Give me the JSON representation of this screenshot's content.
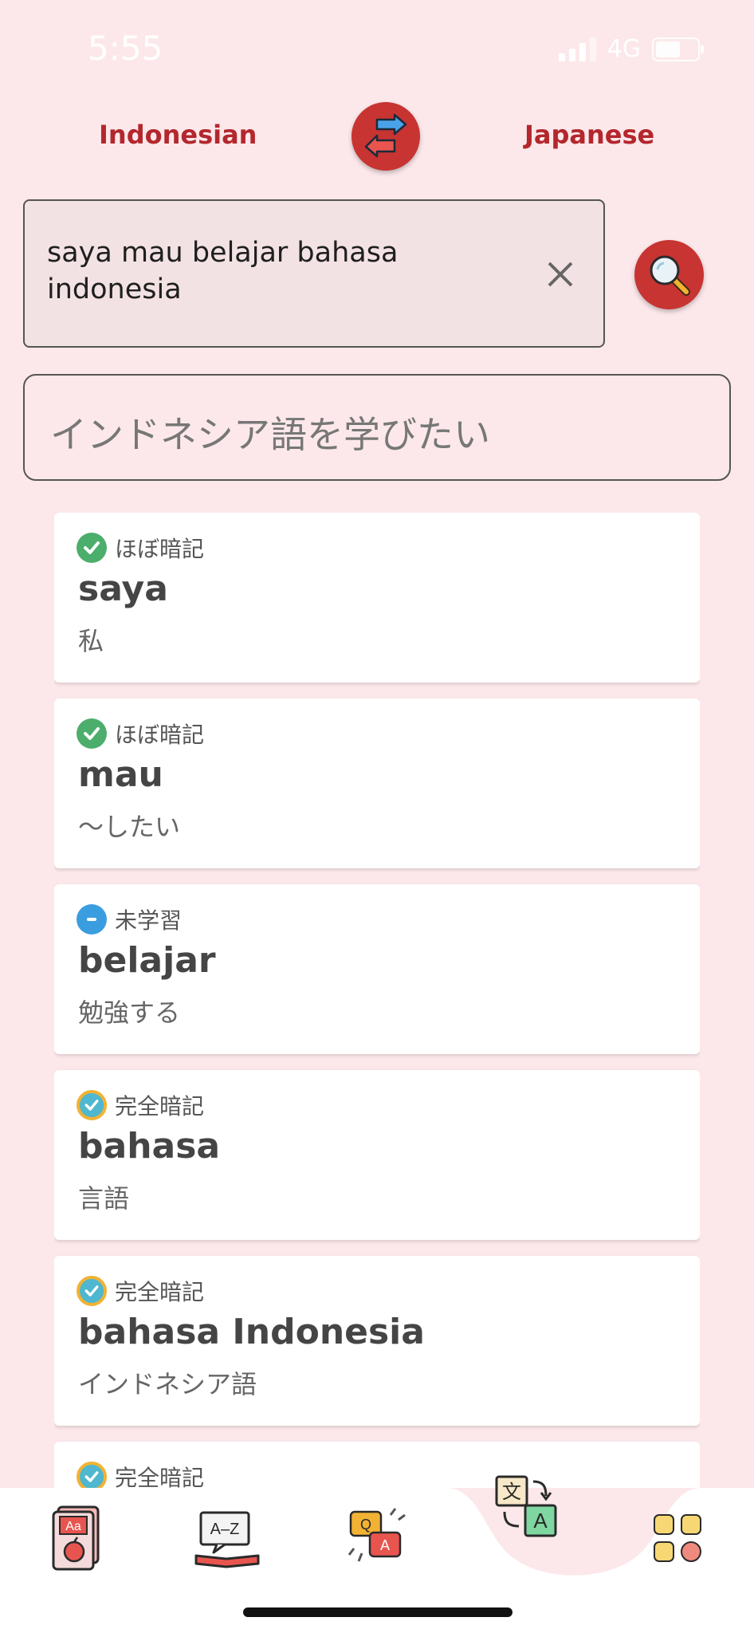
{
  "status_bar": {
    "time": "5:55",
    "network": "4G"
  },
  "header": {
    "source_language": "Indonesian",
    "target_language": "Japanese",
    "swap_icon": "swap-arrows-icon"
  },
  "input": {
    "value": "saya mau belajar bahasa indonesia",
    "clear_icon": "close-icon",
    "search_icon": "magnifier-icon"
  },
  "output": {
    "translation": "インドネシア語を学びたい"
  },
  "words": [
    {
      "status": "ほぼ暗記",
      "status_type": "almost",
      "word": "saya",
      "meaning": "私"
    },
    {
      "status": "ほぼ暗記",
      "status_type": "almost",
      "word": "mau",
      "meaning": "～したい"
    },
    {
      "status": "未学習",
      "status_type": "unlearned",
      "word": "belajar",
      "meaning": "勉強する"
    },
    {
      "status": "完全暗記",
      "status_type": "mastered",
      "word": "bahasa",
      "meaning": "言語"
    },
    {
      "status": "完全暗記",
      "status_type": "mastered",
      "word": "bahasa Indonesia",
      "meaning": "インドネシア語"
    },
    {
      "status": "完全暗記",
      "status_type": "mastered",
      "word": "",
      "meaning": ""
    }
  ],
  "bottom_nav": [
    "flashcard-icon",
    "dictionary-icon",
    "quiz-icon",
    "translate-icon",
    "apps-icon"
  ],
  "colors": {
    "accent": "#c73432",
    "background": "#fce8ea",
    "almost": "#4cae6c",
    "unlearned": "#3a9de0",
    "mastered": "#f2b233"
  }
}
